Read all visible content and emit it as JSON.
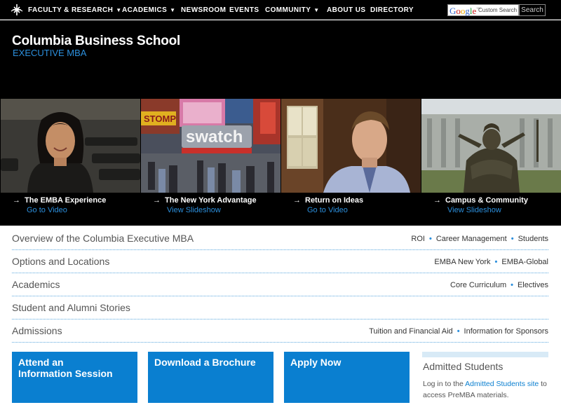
{
  "nav": {
    "items": [
      {
        "label": "FACULTY & RESEARCH",
        "caret": "▼"
      },
      {
        "label": "ACADEMICS",
        "caret": "▼"
      },
      {
        "label": "NEWSROOM",
        "caret": ""
      },
      {
        "label": "EVENTS",
        "caret": ""
      },
      {
        "label": "COMMUNITY",
        "caret": "▼"
      },
      {
        "label": "ABOUT US",
        "caret": ""
      },
      {
        "label": "DIRECTORY",
        "caret": ""
      }
    ],
    "search": {
      "google_label": "Google",
      "custom_search_label": "Custom Search",
      "button_label": "Search"
    }
  },
  "header": {
    "title": "Columbia Business School",
    "subtitle": "EXECUTIVE MBA"
  },
  "hero": {
    "panels": [
      {
        "title": "The EMBA Experience",
        "link": "Go to Video"
      },
      {
        "title": "The New York Advantage",
        "link": "View Slideshow"
      },
      {
        "title": "Return on Ideas",
        "link": "Go to Video"
      },
      {
        "title": "Campus & Community",
        "link": "View Slideshow"
      }
    ],
    "arrow": "→",
    "photo_text": {
      "stomp": "STOMP",
      "swatch": "swatch"
    }
  },
  "menu": [
    {
      "title": "Overview of the Columbia Executive MBA",
      "links": [
        "ROI",
        "Career Management",
        "Students"
      ]
    },
    {
      "title": "Options and Locations",
      "links": [
        "EMBA New York",
        "EMBA-Global"
      ]
    },
    {
      "title": "Academics",
      "links": [
        "Core Curriculum",
        "Electives"
      ]
    },
    {
      "title": "Student and Alumni Stories",
      "links": []
    },
    {
      "title": "Admissions",
      "links": [
        "Tuition and Financial Aid",
        "Information for Sponsors"
      ]
    }
  ],
  "cta": {
    "info_session": "Attend an Information Session",
    "brochure": "Download a Brochure",
    "apply": "Apply Now"
  },
  "admitted": {
    "title": "Admitted Students",
    "text_before": "Log in to the ",
    "link": "Admitted Students site",
    "text_after": " to access PreMBA materials."
  },
  "colors": {
    "accent_blue": "#0a7fd0",
    "link_blue": "#2c8fdc",
    "nav_bg": "#000000"
  }
}
